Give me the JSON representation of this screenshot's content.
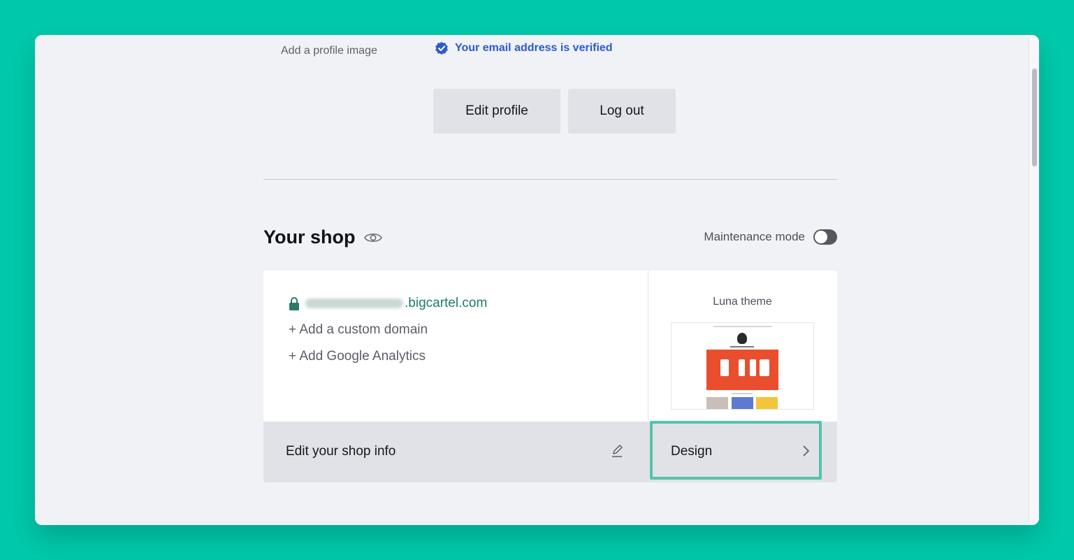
{
  "profile": {
    "add_image_label": "Add a profile image",
    "verified_text": "Your email address is verified",
    "edit_profile_label": "Edit profile",
    "logout_label": "Log out"
  },
  "shop": {
    "title": "Your shop",
    "maintenance_label": "Maintenance mode",
    "maintenance_on": false,
    "domain_suffix": ".bigcartel.com",
    "add_custom_domain": "+ Add a custom domain",
    "add_google_analytics": "+ Add Google Analytics",
    "theme_name": "Luna theme",
    "edit_shop_info": "Edit your shop info",
    "design_label": "Design"
  },
  "colors": {
    "background": "#00c9ab",
    "verified_blue": "#2c5ad0",
    "domain_green": "#1c7b6a",
    "highlight": "#52c4ab"
  },
  "icons": [
    "verified-badge-icon",
    "eye-icon",
    "lock-icon",
    "pencil-icon",
    "chevron-right-icon"
  ]
}
